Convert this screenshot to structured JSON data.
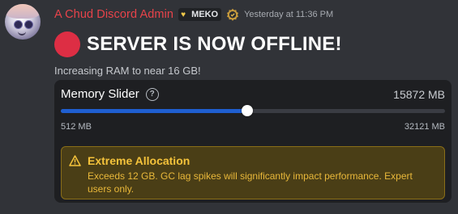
{
  "message": {
    "author": "A Chud Discord Admin",
    "author_color": "#e8434a",
    "badge": {
      "icon": "heart-icon",
      "label": "MEKO"
    },
    "verified_icon": "shield-badge-icon",
    "timestamp": "Yesterday at 11:36 PM",
    "title_emoji": "red-circle-icon",
    "title": "SERVER IS NOW OFFLINE!",
    "subtitle": "Increasing RAM to near 16 GB!"
  },
  "slider": {
    "label": "Memory Slider",
    "help_icon": "question-circle-icon",
    "value_text": "15872 MB",
    "value": 15872,
    "min": 512,
    "max": 32121,
    "min_label": "512 MB",
    "max_label": "32121 MB",
    "fill_color": "#1f5fd1"
  },
  "alert": {
    "icon": "warning-triangle-icon",
    "title": "Extreme Allocation",
    "body": "Exceeds 12 GB. GC lag spikes will significantly impact performance. Expert users only.",
    "color": "#f5c33b"
  }
}
